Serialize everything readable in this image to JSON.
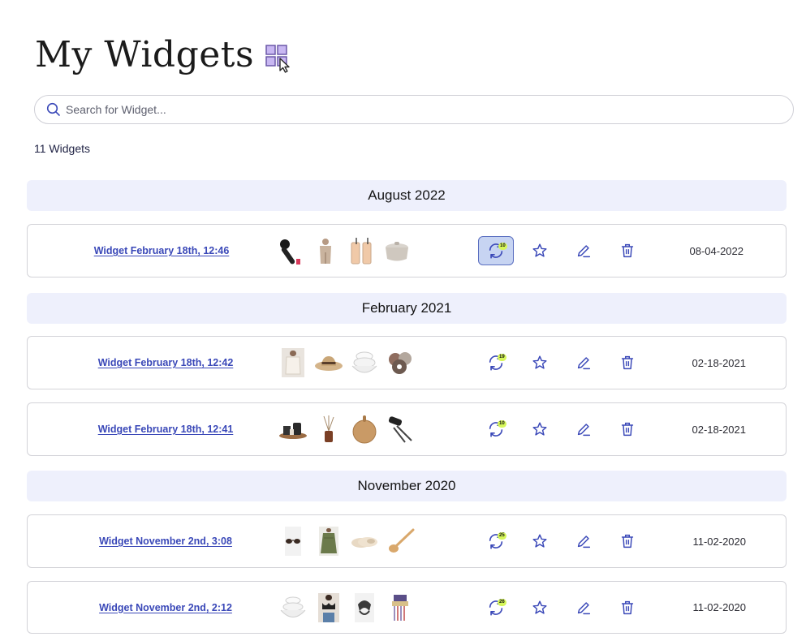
{
  "header": {
    "title": "My Widgets",
    "icon": "widgets-grid-icon"
  },
  "search": {
    "placeholder": "Search for Widget...",
    "value": ""
  },
  "count_label": "11 Widgets",
  "groups": [
    {
      "label": "August 2022"
    },
    {
      "label": "February 2021"
    },
    {
      "label": "November 2020"
    }
  ],
  "rows": [
    {
      "name": "Widget February 18th, 12:46",
      "count": "10",
      "date": "08-04-2022",
      "active": true,
      "thumbs": [
        "hair-dryer-brush",
        "knit-set",
        "glass-tumblers",
        "dutch-oven"
      ]
    },
    {
      "name": "Widget February 18th, 12:42",
      "count": "19",
      "date": "02-18-2021",
      "active": false,
      "thumbs": [
        "knit-cardigan",
        "straw-hat",
        "mixing-bowls",
        "scrunchies"
      ]
    },
    {
      "name": "Widget February 18th, 12:41",
      "count": "10",
      "date": "02-18-2021",
      "active": false,
      "thumbs": [
        "tray-set",
        "reed-diffuser",
        "cutting-board",
        "bbq-tools"
      ]
    },
    {
      "name": "Widget November 2nd, 3:08",
      "count": "25",
      "date": "11-02-2020",
      "active": false,
      "thumbs": [
        "sunglasses",
        "green-dress",
        "slippers",
        "wooden-spoon"
      ]
    },
    {
      "name": "Widget November 2nd, 2:12",
      "count": "26",
      "date": "11-02-2020",
      "active": false,
      "thumbs": [
        "nesting-bowls",
        "bralette",
        "hair-clip",
        "tassel-earrings"
      ]
    }
  ],
  "colors": {
    "accent": "#3a48b8",
    "group_bg": "#eef0fc",
    "badge": "#d6f75a",
    "active_bg": "#c7d4f2"
  }
}
